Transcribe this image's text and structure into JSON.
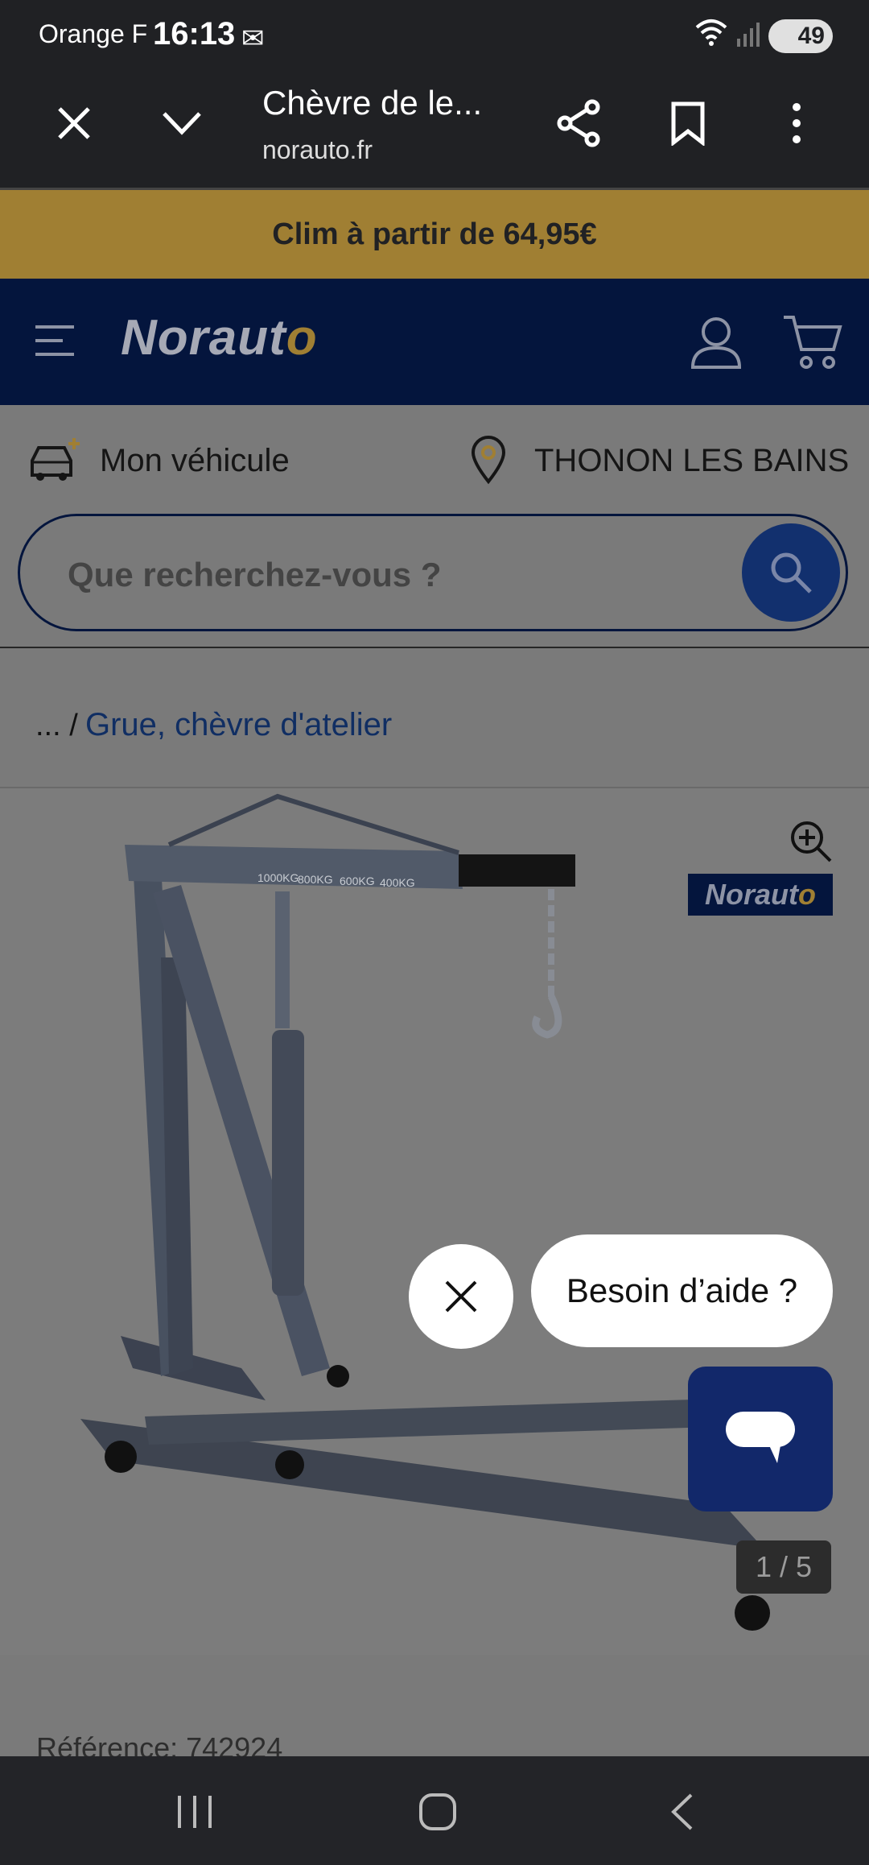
{
  "status_bar": {
    "carrier": "Orange F",
    "time": "16:13",
    "mail_icon": "✉",
    "battery": "49"
  },
  "browser": {
    "title": "Chèvre de le...",
    "url": "norauto.fr"
  },
  "promo": {
    "text": "Clim à partir de 64,95€"
  },
  "header": {
    "logo_main": "Norauto",
    "accent": "#a07f33",
    "brand_color": "#04153d"
  },
  "info": {
    "vehicle_label": "Mon véhicule",
    "store_label": "THONON LES BAINS"
  },
  "search": {
    "placeholder": "Que recherchez-vous ?"
  },
  "breadcrumb": {
    "prefix": "... /",
    "link": "Grue, chèvre d'atelier"
  },
  "product": {
    "badge": "Norauto",
    "counter": "1 / 5",
    "weights": [
      "1000KG",
      "800KG",
      "600KG",
      "400KG"
    ],
    "reference": "Référence: 742924"
  },
  "chat": {
    "bubble": "Besoin d’aide ?"
  }
}
